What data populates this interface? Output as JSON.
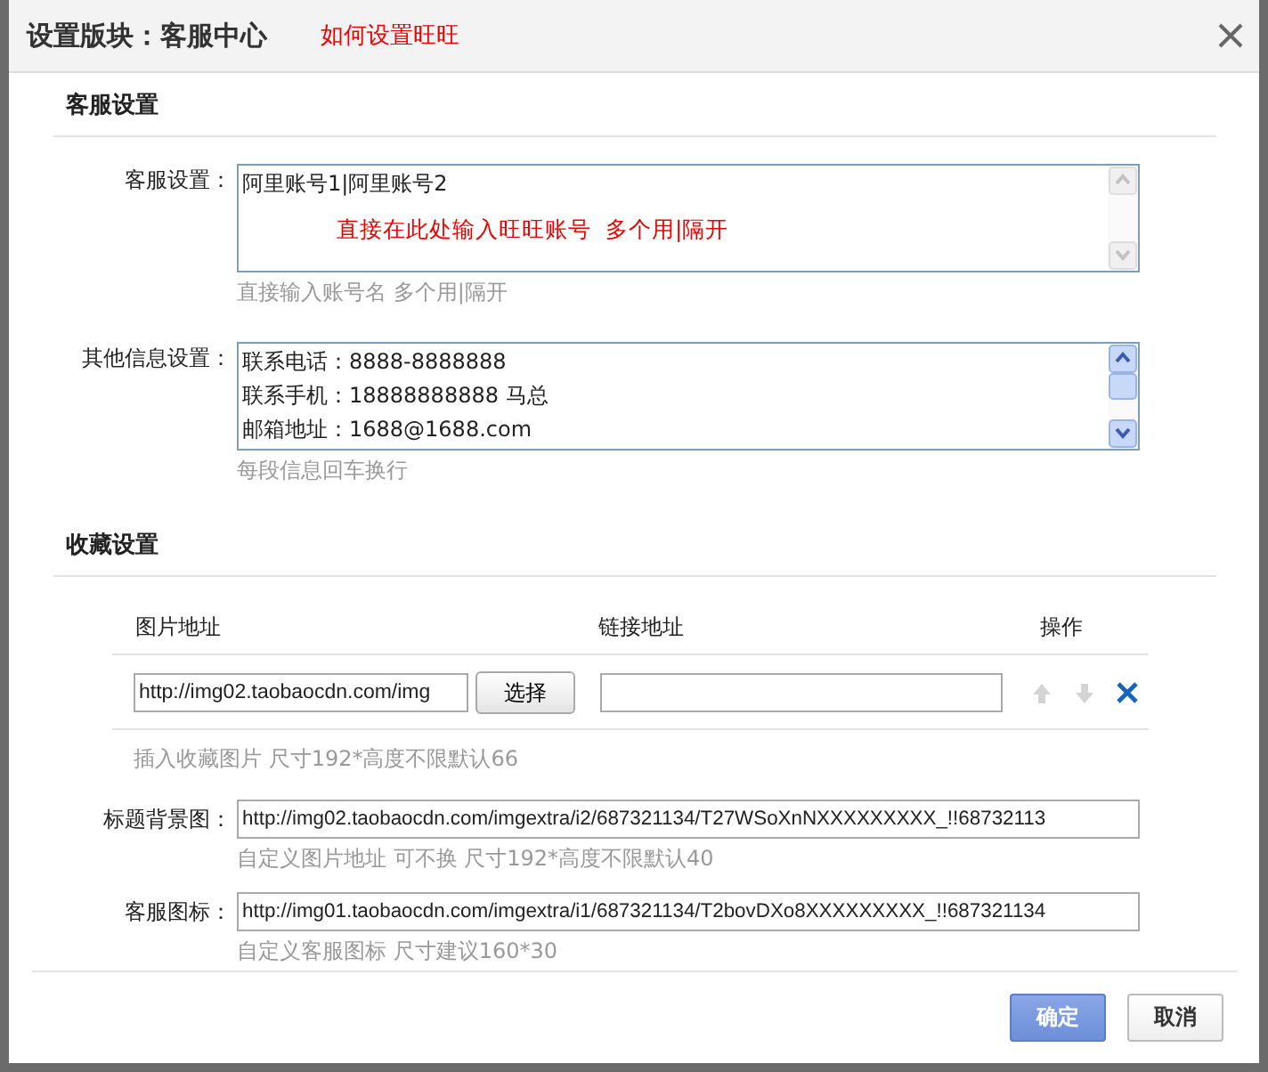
{
  "dialog": {
    "title": "设置版块：客服中心",
    "help_link": "如何设置旺旺"
  },
  "service_section": {
    "heading": "客服设置",
    "fields": [
      {
        "label": "客服设置：",
        "scrollable": false,
        "lines": [
          "阿里账号1|阿里账号2"
        ],
        "annotation": "直接在此处输入旺旺账号  多个用|隔开",
        "hint": "直接输入账号名 多个用|隔开"
      },
      {
        "label": "其他信息设置：",
        "scrollable": true,
        "lines": [
          "联系电话：8888-8888888",
          "联系手机：18888888888 马总",
          "邮箱地址：1688@1688.com"
        ],
        "hint": "每段信息回车换行"
      }
    ]
  },
  "favorites_section": {
    "heading": "收藏设置",
    "table": {
      "columns": [
        "图片地址",
        "链接地址",
        "操作"
      ],
      "rows": [
        {
          "image_url": "http://img02.taobaocdn.com/img",
          "choose_button": "选择",
          "actions": [
            {
              "kind": "up",
              "disabled": true
            },
            {
              "kind": "down",
              "disabled": true
            },
            {
              "kind": "delete",
              "disabled": false
            }
          ]
        }
      ]
    },
    "table_hint": "插入收藏图片 尺寸192*高度不限默认66",
    "fields": [
      {
        "label": "标题背景图：",
        "value": "http://img02.taobaocdn.com/imgextra/i2/687321134/T27WSoXnNXXXXXXXXX_!!68732113",
        "hint": "自定义图片地址 可不换 尺寸192*高度不限默认40"
      },
      {
        "label": "客服图标：",
        "value": "http://img01.taobaocdn.com/imgextra/i1/687321134/T2bovDXo8XXXXXXXXX_!!687321134",
        "hint": "自定义客服图标 尺寸建议160*30"
      }
    ]
  },
  "buttons": [
    {
      "label": "确定",
      "kind": "primary"
    },
    {
      "label": "取消",
      "kind": "secondary"
    }
  ]
}
